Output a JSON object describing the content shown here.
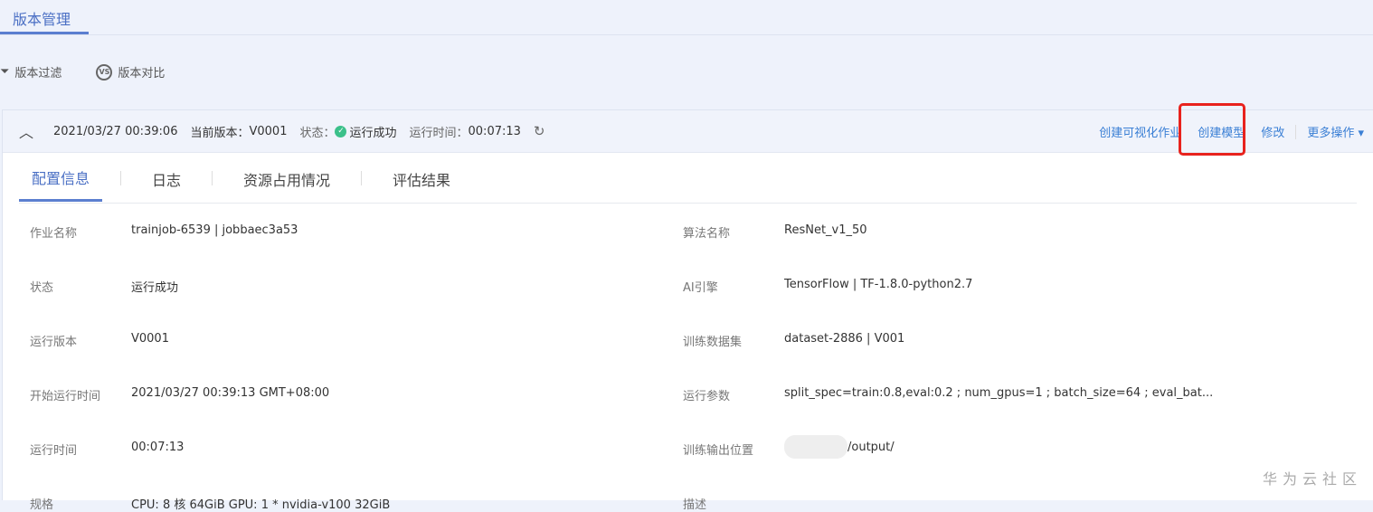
{
  "header": {
    "tab": "版本管理"
  },
  "toolbar": {
    "filter": "版本过滤",
    "compare": "版本对比",
    "compare_icon": "VS"
  },
  "version": {
    "date": "2021/03/27 00:39:06",
    "current_label": "当前版本：",
    "current": "V0001",
    "status_label": "状态：",
    "status": "运行成功",
    "runtime_label": "运行时间：",
    "runtime": "00:07:13"
  },
  "actions": {
    "visualize": "创建可视化作业",
    "create_model": "创建模型",
    "edit": "修改",
    "more": "更多操作 ▾"
  },
  "tabs": [
    "配置信息",
    "日志",
    "资源占用情况",
    "评估结果"
  ],
  "left": [
    {
      "k": "作业名称",
      "v": "trainjob-6539 | jobbaec3a53"
    },
    {
      "k": "状态",
      "v": "运行成功"
    },
    {
      "k": "运行版本",
      "v": "V0001"
    },
    {
      "k": "开始运行时间",
      "v": "2021/03/27 00:39:13 GMT+08:00"
    },
    {
      "k": "运行时间",
      "v": "00:07:13"
    },
    {
      "k": "规格",
      "v": "CPU: 8 核 64GiB GPU: 1 * nvidia-v100 32GiB"
    }
  ],
  "right": [
    {
      "k": "算法名称",
      "v": "ResNet_v1_50"
    },
    {
      "k": "AI引擎",
      "v": "TensorFlow | TF-1.8.0-python2.7"
    },
    {
      "k": "训练数据集",
      "v": "dataset-2886 | V001"
    },
    {
      "k": "运行参数",
      "v": "split_spec=train:0.8,eval:0.2 ; num_gpus=1 ; batch_size=64 ; eval_bat..."
    },
    {
      "k": "训练输出位置",
      "v": "/output/"
    },
    {
      "k": "描述",
      "v": ""
    }
  ],
  "watermark": "华为云社区"
}
